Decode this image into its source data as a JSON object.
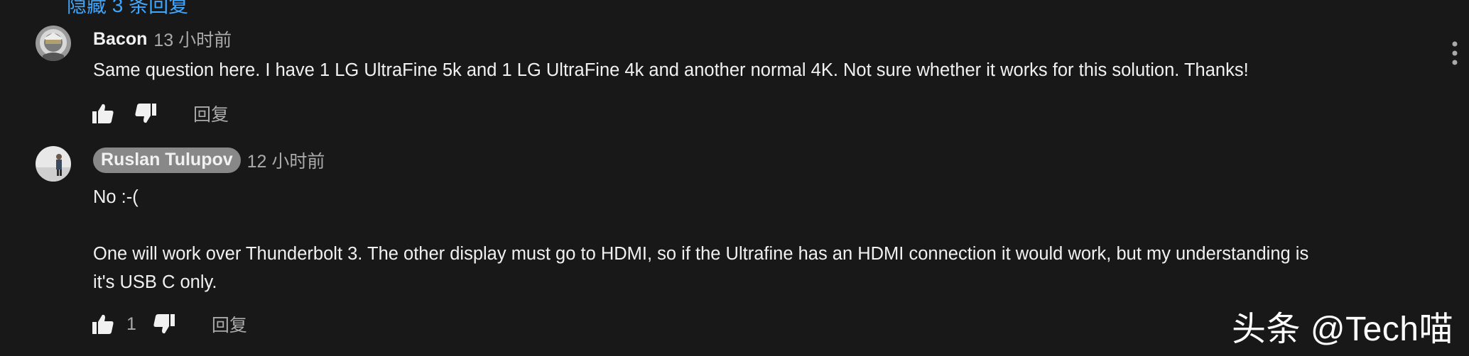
{
  "thread": {
    "hidden_replies_label": "隐藏 3 条回复"
  },
  "comments": [
    {
      "author": "Bacon",
      "time": "13 小时前",
      "text_lines": [
        "Same question here. I have 1 LG UltraFine 5k and 1 LG UltraFine 4k and another normal 4K. Not sure whether it works for this solution. Thanks!"
      ],
      "like_count": "",
      "reply_label": "回复",
      "author_highlighted": false
    },
    {
      "author": "Ruslan Tulupov",
      "time": "12 小时前",
      "text_lines": [
        "No :-(",
        "",
        "One will work over Thunderbolt 3. The other display must go to HDMI, so if the Ultrafine has an HDMI connection it would work, but my understanding is",
        "it's USB C only."
      ],
      "like_count": "1",
      "reply_label": "回复",
      "author_highlighted": true
    }
  ],
  "watermark": "头条 @Tech喵",
  "icons": {
    "like": "thumb-up-icon",
    "dislike": "thumb-down-icon",
    "menu": "more-vertical-icon"
  },
  "colors": {
    "background": "#181818",
    "link": "#3ea6ff",
    "secondary_text": "#aaaaaa",
    "author_pill": "#888888"
  }
}
